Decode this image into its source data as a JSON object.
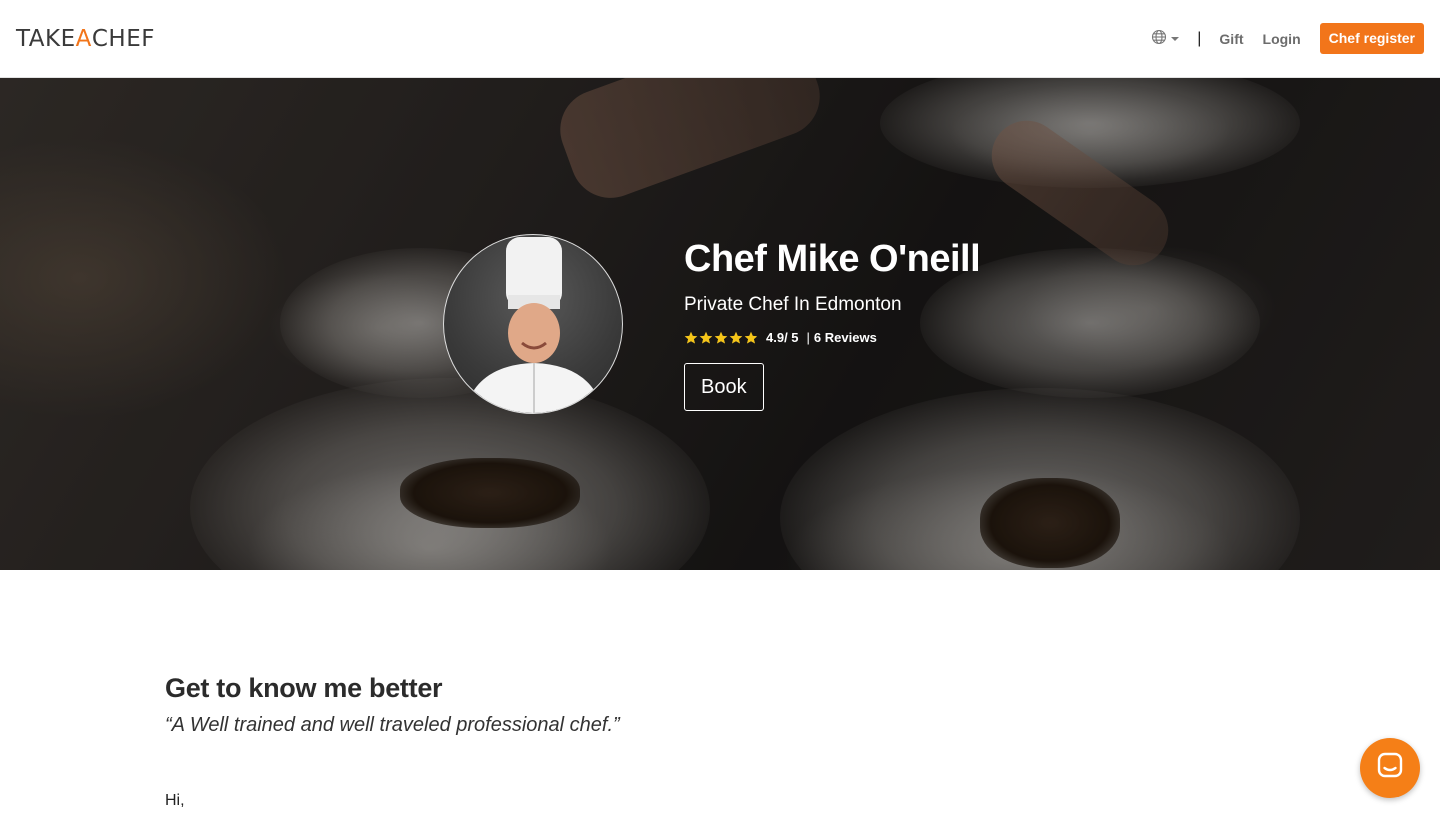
{
  "header": {
    "logo_part1": "TAKE",
    "logo_a": "A",
    "logo_part2": "CHEF",
    "separator": "|",
    "gift_label": "Gift",
    "login_label": "Login",
    "register_label": "Chef register",
    "icons": {
      "language": "globe-icon",
      "dropdown": "caret-down-icon"
    },
    "accent_color": "#f2751a"
  },
  "hero": {
    "chef_name": "Chef Mike O'neill",
    "subtitle": "Private Chef In Edmonton",
    "rating": 4.9,
    "rating_max": 5,
    "rating_text": "4.9/ 5",
    "rating_separator": "|",
    "reviews_text": "6 Reviews",
    "book_label": "Book",
    "star_color": "#f5c518"
  },
  "about": {
    "heading": "Get to know me better",
    "quote": "“A Well trained and well traveled professional chef.”",
    "greeting": "Hi,"
  },
  "chat": {
    "icon": "chat-icon",
    "color": "#f57f17"
  }
}
